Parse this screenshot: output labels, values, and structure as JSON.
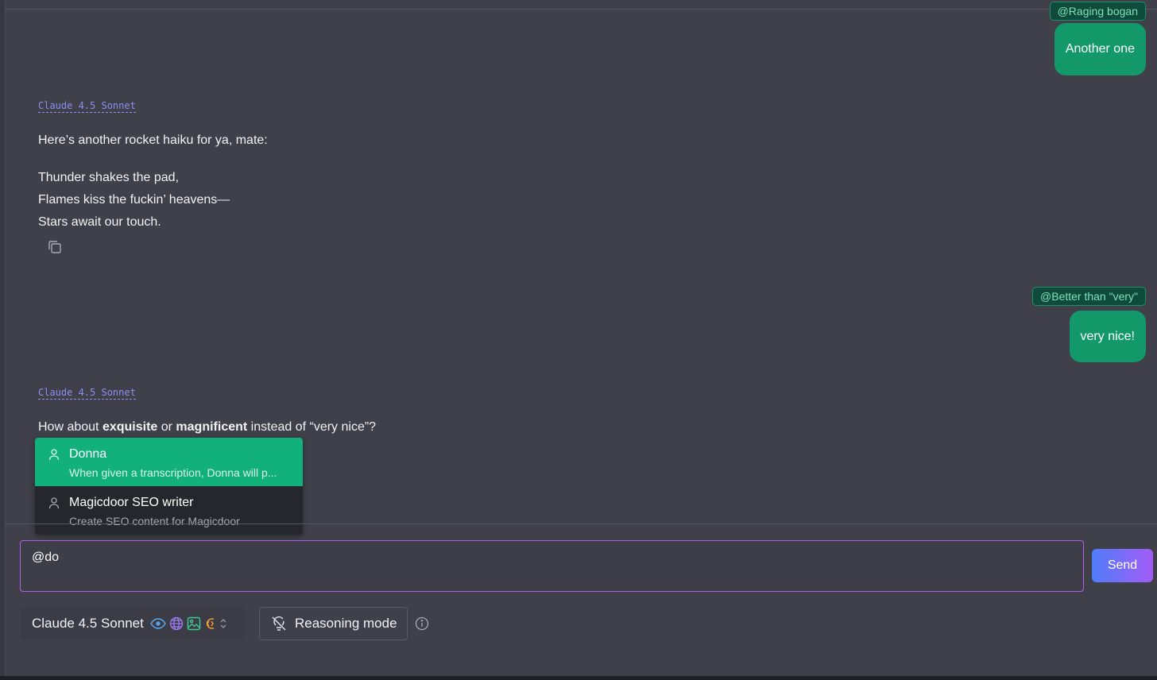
{
  "colors": {
    "accent_green": "#13986a",
    "menu_active": "#12b07a",
    "model_label": "#8b8ff0",
    "input_border": "#b25cf0"
  },
  "messages": [
    {
      "role": "user",
      "persona": "@Raging bogan",
      "text": "Another one"
    },
    {
      "role": "assistant",
      "model": "Claude 4.5 Sonnet",
      "intro": "Here’s another rocket haiku for ya, mate:",
      "lines": [
        "Thunder shakes the pad,",
        "Flames kiss the fuckin’ heavens—",
        "Stars await our touch."
      ]
    },
    {
      "role": "user",
      "persona": "@Better than \"very\"",
      "text": "very nice!"
    },
    {
      "role": "assistant",
      "model": "Claude 4.5 Sonnet",
      "parts": [
        "How about ",
        "exquisite",
        " or ",
        "magnificent",
        " instead of “very nice”?"
      ]
    }
  ],
  "mention_menu": [
    {
      "name": "Donna",
      "desc": "When given a transcription, Donna will p...",
      "icon": "user-icon"
    },
    {
      "name": "Magicdoor SEO writer",
      "desc": "Create SEO content for Magicdoor",
      "icon": "user-icon"
    }
  ],
  "composer": {
    "input_value": "@do",
    "send_label": "Send",
    "model_name": "Claude 4.5 Sonnet",
    "capability_icons": [
      "eye-icon",
      "globe-icon",
      "image-icon",
      "code-icon",
      "chevron-updown-icon"
    ],
    "reasoning_label": "Reasoning mode",
    "info_icon": "info-icon"
  }
}
